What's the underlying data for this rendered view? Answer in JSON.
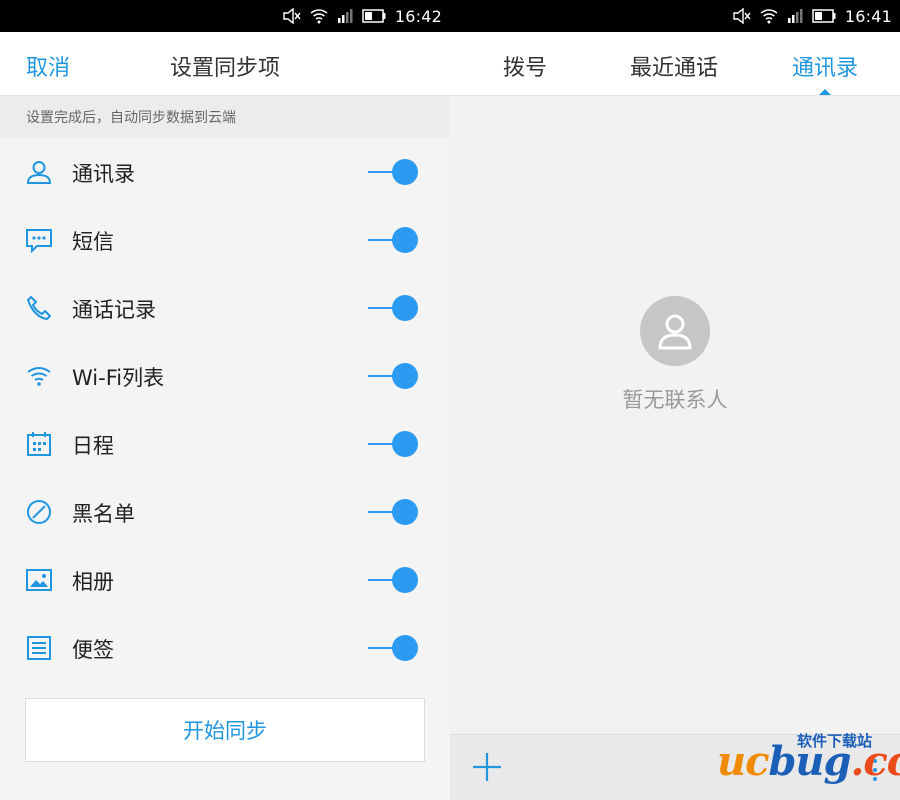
{
  "colors": {
    "accent": "#2196e0",
    "toggle_on": "#2a9bf0"
  },
  "left_status": {
    "time": "16:42"
  },
  "right_status": {
    "time": "16:41"
  },
  "sync_settings": {
    "cancel_label": "取消",
    "title": "设置同步项",
    "hint": "设置完成后，自动同步数据到云端",
    "items": [
      {
        "icon": "contact-icon",
        "label": "通讯录",
        "enabled": true
      },
      {
        "icon": "sms-icon",
        "label": "短信",
        "enabled": true
      },
      {
        "icon": "phone-icon",
        "label": "通话记录",
        "enabled": true
      },
      {
        "icon": "wifi-icon",
        "label": "Wi-Fi列表",
        "enabled": true
      },
      {
        "icon": "calendar-icon",
        "label": "日程",
        "enabled": true
      },
      {
        "icon": "blocked-icon",
        "label": "黑名单",
        "enabled": true
      },
      {
        "icon": "image-icon",
        "label": "相册",
        "enabled": true
      },
      {
        "icon": "note-icon",
        "label": "便签",
        "enabled": true
      }
    ],
    "start_button": "开始同步"
  },
  "dialer": {
    "tabs": [
      {
        "label": "拨号",
        "active": false
      },
      {
        "label": "最近通话",
        "active": false
      },
      {
        "label": "通讯录",
        "active": true
      }
    ],
    "empty_text": "暂无联系人"
  },
  "watermark": {
    "main": "ucbug.cc",
    "sub": "软件下载站"
  }
}
